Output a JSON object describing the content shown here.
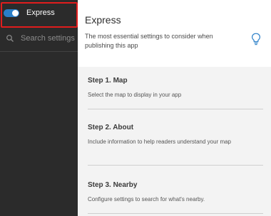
{
  "sidebar": {
    "express_label": "Express",
    "search_placeholder": "Search settings"
  },
  "header": {
    "title": "Express",
    "description": "The most essential settings to consider when publishing this app"
  },
  "steps": [
    {
      "title": "Step 1. Map",
      "description": "Select the map to display in your app"
    },
    {
      "title": "Step 2. About",
      "description": "Include information to help readers understand your map"
    },
    {
      "title": "Step 3. Nearby",
      "description": "Configure settings to search for what's nearby."
    }
  ],
  "colors": {
    "sidebar_bg": "#2b2b2b",
    "toggle_on": "#2a7fc8",
    "highlight": "#e11d1d",
    "bulb": "#2a7fc8"
  },
  "icons": {
    "toggle": "toggle-switch-icon",
    "search": "search-icon",
    "tip": "lightbulb-icon"
  }
}
